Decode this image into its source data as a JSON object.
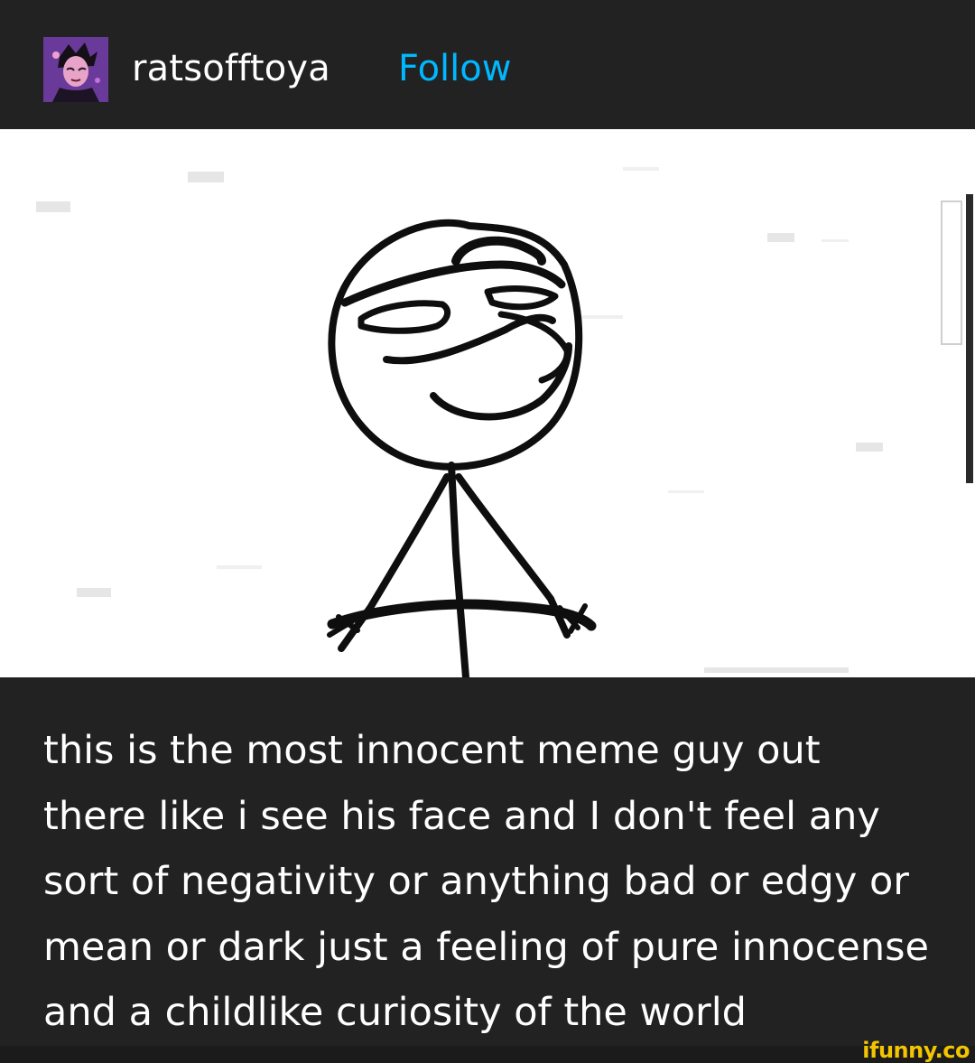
{
  "post": {
    "username": "ratsofftoya",
    "follow_label": "Follow"
  },
  "caption": {
    "lines": [
      "this is the most innocent meme guy out",
      "there like i see his face and I don't feel any",
      "sort of negativity or anything bad or edgy or",
      "mean or dark just a feeling of pure innocense",
      "and a childlike curiosity of the world"
    ]
  },
  "watermark": "ifunny.co",
  "colors": {
    "background": "#222222",
    "follow_accent": "#00b8ff",
    "watermark": "#f2c500"
  },
  "icons": {
    "avatar": "user-avatar-portrait",
    "meme": "stick-figure-meme-drawing"
  }
}
